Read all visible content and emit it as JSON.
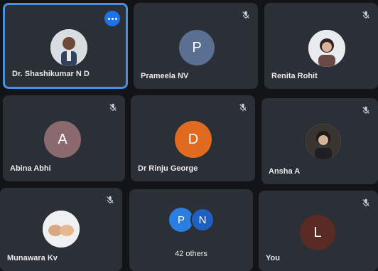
{
  "participants": [
    {
      "name": "Dr. Shashikumar N D",
      "muted": false,
      "active": true,
      "avatar_type": "photo"
    },
    {
      "name": "Prameela NV",
      "initial": "P",
      "color": "#5a7092",
      "muted": true
    },
    {
      "name": "Renita Rohit",
      "muted": true,
      "avatar_type": "photo"
    },
    {
      "name": "Abina Abhi",
      "initial": "A",
      "color": "#8a6a6f",
      "muted": true
    },
    {
      "name": "Dr Rinju George",
      "initial": "D",
      "color": "#e06a1f",
      "muted": true
    },
    {
      "name": "Ansha A",
      "muted": true,
      "avatar_type": "photo"
    },
    {
      "name": "Munawara Kv",
      "muted": true,
      "avatar_type": "photo"
    },
    {
      "others_label": "42 others",
      "initials": [
        "P",
        "N"
      ],
      "colors": [
        "#2a7de1",
        "#1f5fbf"
      ]
    },
    {
      "name": "You",
      "initial": "L",
      "color": "#5a2a24",
      "muted": true
    }
  ],
  "icons": {
    "mute": "mic-off-icon",
    "more": "more-options-icon"
  },
  "colors": {
    "tile_bg": "#2b2f36",
    "active_border": "#4a90e2",
    "more_button": "#1a73e8"
  }
}
